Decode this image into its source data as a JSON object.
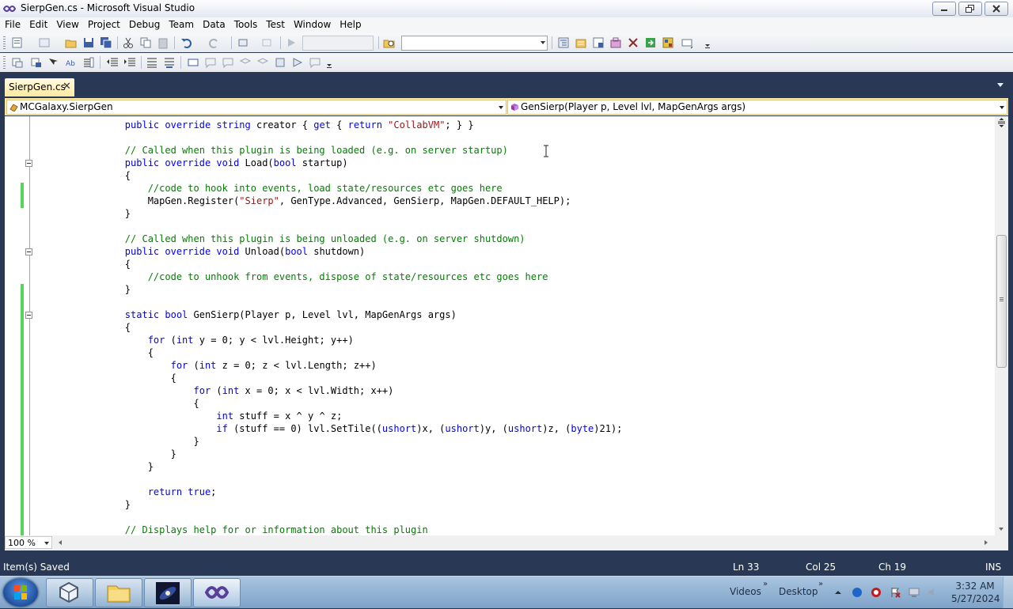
{
  "window": {
    "title": "SierpGen.cs - Microsoft Visual Studio"
  },
  "menu": [
    "File",
    "Edit",
    "View",
    "Project",
    "Debug",
    "Team",
    "Data",
    "Tools",
    "Test",
    "Window",
    "Help"
  ],
  "toolbar1": {
    "icons": [
      "new-project-icon",
      "add-item-icon",
      "open-file-icon",
      "save-icon",
      "save-all-icon",
      "cut-icon",
      "copy-icon",
      "paste-icon",
      "undo-icon",
      "redo-icon",
      "navigate-backward-icon",
      "navigate-forward-icon",
      "start-debugging-icon",
      "find-in-files-icon",
      "solution-explorer-icon",
      "properties-icon",
      "object-browser-icon",
      "toolbox-icon",
      "start-page-icon",
      "extension-manager-icon",
      "command-window-icon"
    ],
    "configuration_value": "",
    "find_value": ""
  },
  "toolbar2": {
    "icons": [
      "list-members-icon",
      "parameter-info-icon",
      "quick-info-icon",
      "word-completion-icon",
      "decrease-indent-icon",
      "increase-indent-icon",
      "comment-lines-icon",
      "uncomment-lines-icon",
      "toggle-bookmark-icon",
      "previous-bookmark-icon",
      "next-bookmark-icon",
      "bookmark-folder-icon",
      "next-bookmark-in-folder-icon",
      "clear-bookmarks-icon"
    ]
  },
  "tabs": [
    {
      "label": "SierpGen.cs",
      "active": true
    }
  ],
  "navbar": {
    "type_combo": "MCGalaxy.SierpGen",
    "member_combo": "GenSierp(Player p, Level lvl, MapGenArgs args)"
  },
  "code_lines": [
    [
      [
        "kw",
        "        public override string "
      ],
      [
        "pl",
        "creator { "
      ],
      [
        "kw",
        "get"
      ],
      [
        "pl",
        " { "
      ],
      [
        "kw",
        "return "
      ],
      [
        "st",
        "\"CollabVM\""
      ],
      [
        "pl",
        "; } }"
      ]
    ],
    [
      [
        "pl",
        ""
      ]
    ],
    [
      [
        "cm",
        "        // Called when this plugin is being loaded (e.g. on server startup)"
      ]
    ],
    [
      [
        "kw",
        "        public override void "
      ],
      [
        "pl",
        "Load("
      ],
      [
        "kw",
        "bool"
      ],
      [
        "pl",
        " startup)"
      ]
    ],
    [
      [
        "pl",
        "        {"
      ]
    ],
    [
      [
        "cm",
        "            //code to hook into events, load state/resources etc goes here"
      ]
    ],
    [
      [
        "pl",
        "            MapGen.Register("
      ],
      [
        "st",
        "\"Sierp\""
      ],
      [
        "pl",
        ", GenType.Advanced, GenSierp, MapGen.DEFAULT_HELP);"
      ]
    ],
    [
      [
        "pl",
        "        }"
      ]
    ],
    [
      [
        "pl",
        ""
      ]
    ],
    [
      [
        "cm",
        "        // Called when this plugin is being unloaded (e.g. on server shutdown)"
      ]
    ],
    [
      [
        "kw",
        "        public override void "
      ],
      [
        "pl",
        "Unload("
      ],
      [
        "kw",
        "bool"
      ],
      [
        "pl",
        " shutdown)"
      ]
    ],
    [
      [
        "pl",
        "        {"
      ]
    ],
    [
      [
        "cm",
        "            //code to unhook from events, dispose of state/resources etc goes here"
      ]
    ],
    [
      [
        "pl",
        "        }"
      ]
    ],
    [
      [
        "pl",
        ""
      ]
    ],
    [
      [
        "kw",
        "        static bool "
      ],
      [
        "pl",
        "GenSierp(Player p, Level lvl, MapGenArgs args)"
      ]
    ],
    [
      [
        "pl",
        "        {"
      ]
    ],
    [
      [
        "kw",
        "            for"
      ],
      [
        "pl",
        " ("
      ],
      [
        "kw",
        "int"
      ],
      [
        "pl",
        " y = 0; y < lvl.Height; y++)"
      ]
    ],
    [
      [
        "pl",
        "            {"
      ]
    ],
    [
      [
        "kw",
        "                for"
      ],
      [
        "pl",
        " ("
      ],
      [
        "kw",
        "int"
      ],
      [
        "pl",
        " z = 0; z < lvl.Length; z++)"
      ]
    ],
    [
      [
        "pl",
        "                {"
      ]
    ],
    [
      [
        "kw",
        "                    for"
      ],
      [
        "pl",
        " ("
      ],
      [
        "kw",
        "int"
      ],
      [
        "pl",
        " x = 0; x < lvl.Width; x++)"
      ]
    ],
    [
      [
        "pl",
        "                    {"
      ]
    ],
    [
      [
        "kw",
        "                        int"
      ],
      [
        "pl",
        " stuff = x ^ y ^ z;"
      ]
    ],
    [
      [
        "kw",
        "                        if"
      ],
      [
        "pl",
        " (stuff == 0) lvl.SetTile(("
      ],
      [
        "kw",
        "ushort"
      ],
      [
        "pl",
        ")x, ("
      ],
      [
        "kw",
        "ushort"
      ],
      [
        "pl",
        ")y, ("
      ],
      [
        "kw",
        "ushort"
      ],
      [
        "pl",
        ")z, ("
      ],
      [
        "kw",
        "byte"
      ],
      [
        "pl",
        ")21);"
      ]
    ],
    [
      [
        "pl",
        "                    }"
      ]
    ],
    [
      [
        "pl",
        "                }"
      ]
    ],
    [
      [
        "pl",
        "            }"
      ]
    ],
    [
      [
        "pl",
        ""
      ]
    ],
    [
      [
        "kw",
        "            return true"
      ],
      [
        "pl",
        ";"
      ]
    ],
    [
      [
        "pl",
        "        }"
      ]
    ],
    [
      [
        "pl",
        ""
      ]
    ],
    [
      [
        "cm",
        "        // Displays help for or information about this plugin"
      ]
    ]
  ],
  "editor": {
    "zoom": "100 %",
    "colors": {
      "keyword": "#0000ff",
      "comment": "#008000",
      "string": "#a31515",
      "changed": "#57d55a"
    }
  },
  "status": {
    "message": "Item(s) Saved",
    "line": "Ln 33",
    "column": "Col 25",
    "char": "Ch 19",
    "mode": "INS"
  },
  "taskbar": {
    "items": [
      "virtualbox-icon",
      "file-explorer-icon",
      "galaxy-image-icon",
      "visual-studio-icon"
    ],
    "toolbars": [
      "Videos",
      "Desktop"
    ],
    "time": "3:32 AM",
    "date": "5/27/2024"
  }
}
